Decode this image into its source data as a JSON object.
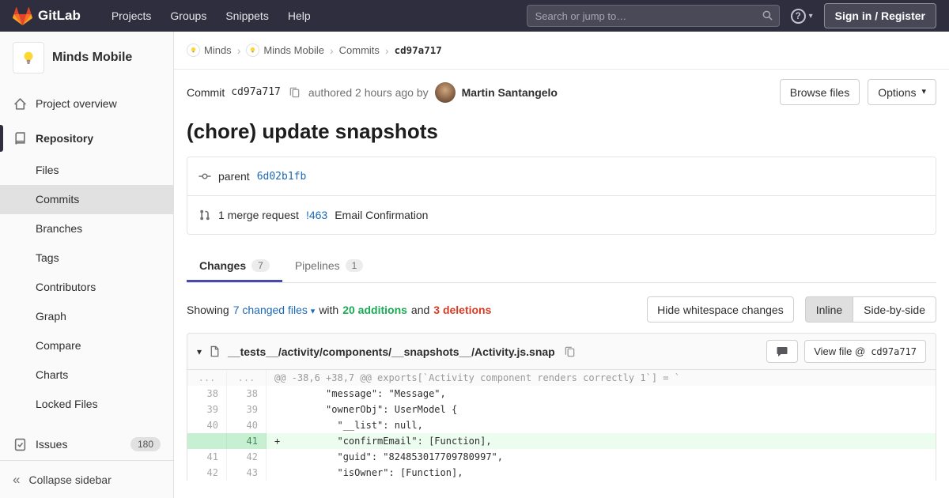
{
  "colors": {
    "navbar_bg": "#2e2e3e",
    "accent": "#4b4ba3",
    "link": "#1b69b6",
    "additions_green": "#1aaa55",
    "deletions_red": "#db3b21",
    "added_line_bg": "#ecfdf0",
    "added_line_number_bg": "#c7f0d2",
    "tanuki_red": "#e24329",
    "tanuki_orange": "#fc6d26",
    "tanuki_yellow": "#fca326"
  },
  "icons": {
    "chevron_down": "▾",
    "breadcrumb_separator": "›",
    "collapse_chevrons": "«",
    "help": "?"
  },
  "navbar": {
    "brand": "GitLab",
    "menu": [
      "Projects",
      "Groups",
      "Snippets",
      "Help"
    ],
    "search_placeholder": "Search or jump to…",
    "sign_in_label": "Sign in / Register"
  },
  "sidebar": {
    "project_name": "Minds Mobile",
    "project_overview": "Project overview",
    "repository": "Repository",
    "repo_items": [
      "Files",
      "Commits",
      "Branches",
      "Tags",
      "Contributors",
      "Graph",
      "Compare",
      "Charts",
      "Locked Files"
    ],
    "issues_label": "Issues",
    "issues_count": "180",
    "collapse_label": "Collapse sidebar"
  },
  "breadcrumb": {
    "group": "Minds",
    "project": "Minds Mobile",
    "section": "Commits",
    "current": "cd97a717"
  },
  "commit": {
    "label": "Commit",
    "sha": "cd97a717",
    "authored_text": "authored 2 hours ago by",
    "author": "Martin Santangelo",
    "browse_files_label": "Browse files",
    "options_label": "Options",
    "title": "(chore) update snapshots",
    "parent_label": "parent",
    "parent_sha": "6d02b1fb",
    "mr_text": "1 merge request",
    "mr_ref": "!463",
    "mr_title": "Email Confirmation"
  },
  "tabs": {
    "changes_label": "Changes",
    "changes_count": "7",
    "pipelines_label": "Pipelines",
    "pipelines_count": "1"
  },
  "summary": {
    "showing": "Showing",
    "changed_files_link": "7 changed files",
    "with_text": "with",
    "additions": "20 additions",
    "and_text": "and",
    "deletions": "3 deletions",
    "hide_whitespace_label": "Hide whitespace changes",
    "inline_label": "Inline",
    "side_by_side_label": "Side-by-side"
  },
  "diff": {
    "file_path": "__tests__/activity/components/__snapshots__/Activity.js.snap",
    "view_file_label": "View file @",
    "view_file_sha": "cd97a717",
    "rows": [
      {
        "old": "...",
        "new": "...",
        "sign": "",
        "text": "@@ -38,6 +38,7 @@ exports[`Activity component renders correctly 1`] = `"
      },
      {
        "old": "38",
        "new": "38",
        "sign": " ",
        "text": "        \"message\": \"Message\","
      },
      {
        "old": "39",
        "new": "39",
        "sign": " ",
        "text": "        \"ownerObj\": UserModel {"
      },
      {
        "old": "40",
        "new": "40",
        "sign": " ",
        "text": "          \"__list\": null,"
      },
      {
        "old": "",
        "new": "41",
        "sign": "+",
        "text": "          \"confirmEmail\": [Function],"
      },
      {
        "old": "41",
        "new": "42",
        "sign": " ",
        "text": "          \"guid\": \"824853017709780997\","
      },
      {
        "old": "42",
        "new": "43",
        "sign": " ",
        "text": "          \"isOwner\": [Function],"
      }
    ]
  }
}
